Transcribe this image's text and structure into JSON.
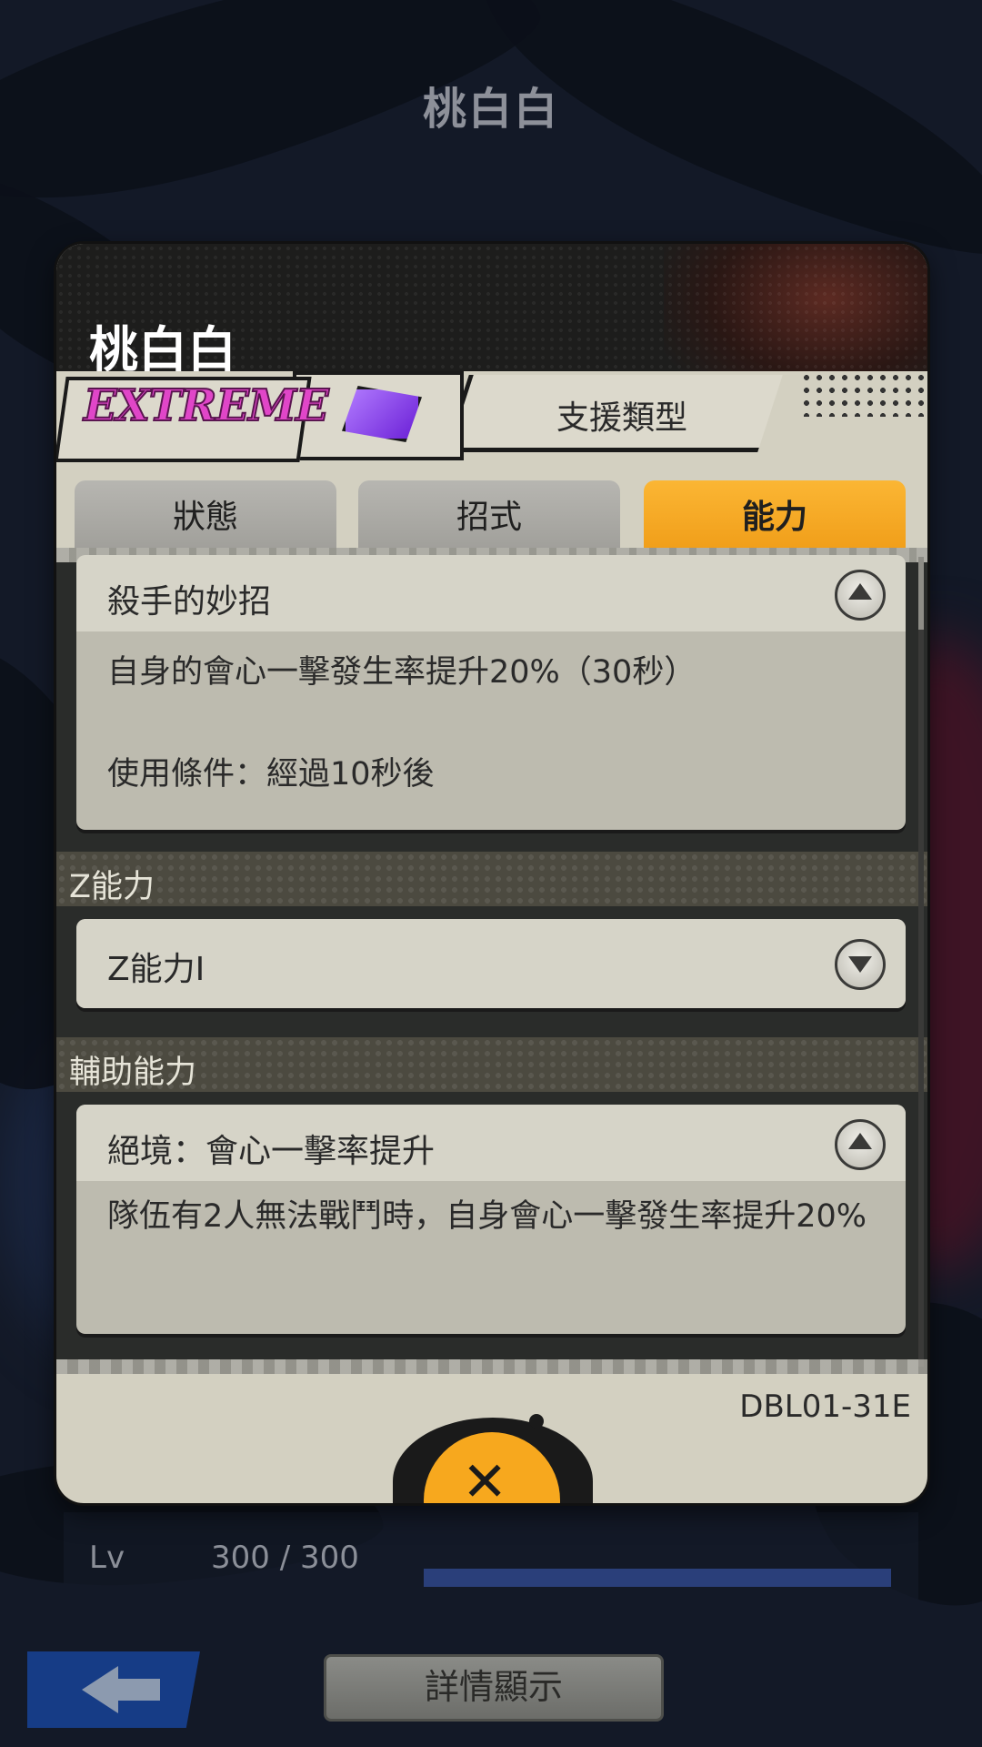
{
  "background": {
    "title": "桃白白",
    "level_label": "Lv",
    "level_value": "300 / 300",
    "level_progress": 1.0,
    "detail_button_label": "詳情顯示"
  },
  "modal": {
    "title": "桃白白",
    "rarity": "EXTREME",
    "element_icon": "purple-gem-icon",
    "type_label": "支援類型",
    "tabs": [
      {
        "label": "狀態",
        "active": false
      },
      {
        "label": "招式",
        "active": false
      },
      {
        "label": "能力",
        "active": true
      }
    ],
    "abilities": {
      "main": {
        "title": "殺手的妙招",
        "expanded": true,
        "description": "自身的會心一擊發生率提升20%（30秒）",
        "condition": "使用條件：經過10秒後"
      },
      "z_section_title": "Z能力",
      "z_ability": {
        "title": "Z能力I",
        "expanded": false
      },
      "support_section_title": "輔助能力",
      "support_ability": {
        "title": "絕境：會心一擊率提升",
        "expanded": true,
        "description": "隊伍有2人無法戰鬥時，自身會心一擊發生率提升20%"
      }
    },
    "card_id": "DBL01-31E",
    "close_icon": "close-icon"
  },
  "colors": {
    "accent_orange": "#f7a81e",
    "rarity_pink": "#e046c8",
    "element_purple": "#8a3cf0"
  }
}
